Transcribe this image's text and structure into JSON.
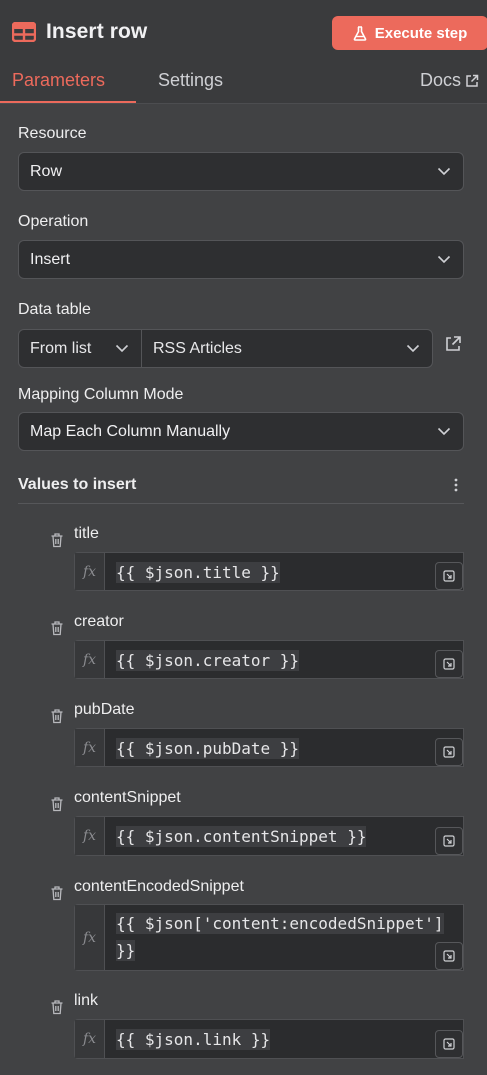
{
  "header": {
    "title": "Insert row",
    "execute_label": "Execute step",
    "accent_color": "#ec6a5c"
  },
  "tabs": [
    {
      "label": "Parameters",
      "active": true
    },
    {
      "label": "Settings",
      "active": false
    },
    {
      "label": "Docs",
      "active": false
    }
  ],
  "resource": {
    "label": "Resource",
    "value": "Row"
  },
  "operation": {
    "label": "Operation",
    "value": "Insert"
  },
  "data_table": {
    "label": "Data table",
    "mode": "From list",
    "value": "RSS Articles"
  },
  "mapping_mode": {
    "label": "Mapping Column Mode",
    "value": "Map Each Column Manually"
  },
  "values_to_insert": {
    "label": "Values to insert",
    "fx_label": "fx",
    "columns": [
      {
        "name": "title",
        "expression": "{{ $json.title }}"
      },
      {
        "name": "creator",
        "expression": "{{ $json.creator }}"
      },
      {
        "name": "pubDate",
        "expression": "{{ $json.pubDate }}"
      },
      {
        "name": "contentSnippet",
        "expression": "{{ $json.contentSnippet }}"
      },
      {
        "name": "contentEncodedSnippet",
        "expression_line1": "{{ $json['content:encodedSnippet']",
        "expression_line2": "}}"
      },
      {
        "name": "link",
        "expression": "{{ $json.link }}"
      }
    ]
  },
  "icons": {
    "node": "table-icon",
    "execute": "flask-icon",
    "docs": "external-link-icon",
    "select": "chevron-down-icon",
    "menu": "kebab-menu-icon",
    "delete": "trash-icon",
    "expand": "expand-icon"
  }
}
